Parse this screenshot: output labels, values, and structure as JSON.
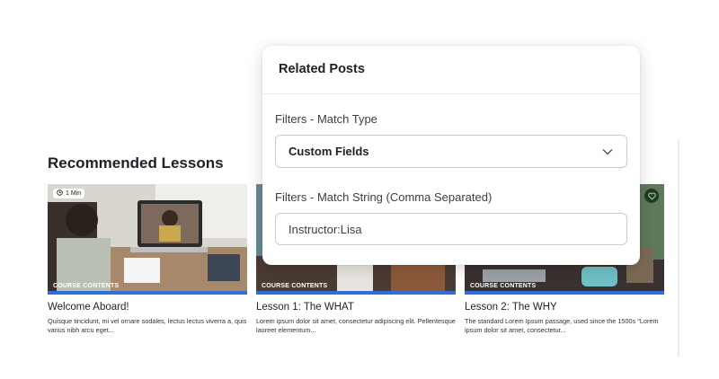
{
  "section": {
    "title": "Recommended Lessons"
  },
  "cards": [
    {
      "title": "Welcome Aboard!",
      "description": "Quisque tincidunt, mi vel ornare sodales, lectus lectus viverra a, quis varius nibh arcu eget...",
      "badge": "COURSE CONTENTS",
      "duration": "1 Min",
      "icon": "clock-icon"
    },
    {
      "title": "Lesson 1: The WHAT",
      "description": "Lorem ipsum dolor sit amet, consectetur adipiscing elit. Pellentesque laoreet elementum...",
      "badge": "COURSE CONTENTS"
    },
    {
      "title": "Lesson 2: The WHY",
      "description": "The standard Lorem Ipsum passage, used since the 1500s \"Lorem ipsum dolor sit amet, consectetur...",
      "badge": "COURSE CONTENTS",
      "icon": "heart-icon"
    }
  ],
  "popup": {
    "title": "Related Posts",
    "match_type_label": "Filters - Match Type",
    "match_type_value": "Custom Fields",
    "match_string_label": "Filters - Match String (Comma Separated)",
    "match_string_value": "Instructor:Lisa"
  },
  "colors": {
    "accent": "#2f6fd6",
    "border": "#c9cdd2",
    "text": "#1d2127"
  }
}
